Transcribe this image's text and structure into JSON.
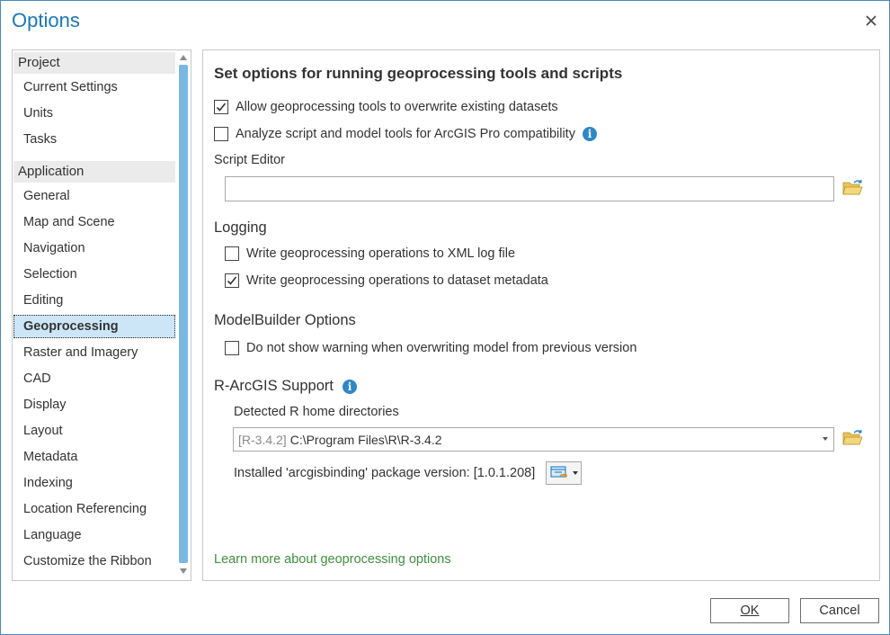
{
  "window": {
    "title": "Options"
  },
  "sidebar": {
    "groups": [
      {
        "label": "Project"
      },
      {
        "label": "Application"
      }
    ],
    "project_items": [
      {
        "label": "Current Settings"
      },
      {
        "label": "Units"
      },
      {
        "label": "Tasks"
      }
    ],
    "application_items": [
      {
        "label": "General"
      },
      {
        "label": "Map and Scene"
      },
      {
        "label": "Navigation"
      },
      {
        "label": "Selection"
      },
      {
        "label": "Editing"
      },
      {
        "label": "Geoprocessing",
        "selected": true
      },
      {
        "label": "Raster and Imagery"
      },
      {
        "label": "CAD"
      },
      {
        "label": "Display"
      },
      {
        "label": "Layout"
      },
      {
        "label": "Metadata"
      },
      {
        "label": "Indexing"
      },
      {
        "label": "Location Referencing"
      },
      {
        "label": "Language"
      },
      {
        "label": "Customize the Ribbon"
      }
    ]
  },
  "panel": {
    "heading": "Set options for running geoprocessing tools and scripts",
    "overwrite": {
      "label": "Allow geoprocessing tools to overwrite existing datasets",
      "checked": true
    },
    "analyze": {
      "label": "Analyze script and model tools for ArcGIS Pro compatibility",
      "checked": false
    },
    "script_editor": {
      "label": "Script Editor",
      "value": ""
    },
    "logging": {
      "title": "Logging",
      "xml_log": {
        "label": "Write geoprocessing operations to XML log file",
        "checked": false
      },
      "metadata": {
        "label": "Write geoprocessing operations to dataset metadata",
        "checked": true
      }
    },
    "modelbuilder": {
      "title": "ModelBuilder Options",
      "no_warning": {
        "label": "Do not show warning when overwriting model from previous version",
        "checked": false
      }
    },
    "r_arcgis": {
      "title": "R-ArcGIS Support",
      "detected_label": "Detected R home directories",
      "selected_version": "[R-3.4.2]",
      "selected_path": "C:\\Program Files\\R\\R-3.4.2",
      "package_label": "Installed 'arcgisbinding' package version: [1.0.1.208]"
    },
    "learn_more": "Learn more about geoprocessing options"
  },
  "footer": {
    "ok_label": "OK",
    "cancel_label": "Cancel"
  },
  "colors": {
    "accent": "#1b77b9",
    "selection": "#cde6f7",
    "scroll_thumb": "#7ab8e2",
    "link": "#3f8f3f",
    "info": "#2e87c8"
  },
  "icons": {
    "close": "close-icon",
    "folder": "folder-open-icon",
    "info": "info-icon",
    "package": "package-update-icon",
    "checkmark": "checkmark-icon"
  }
}
